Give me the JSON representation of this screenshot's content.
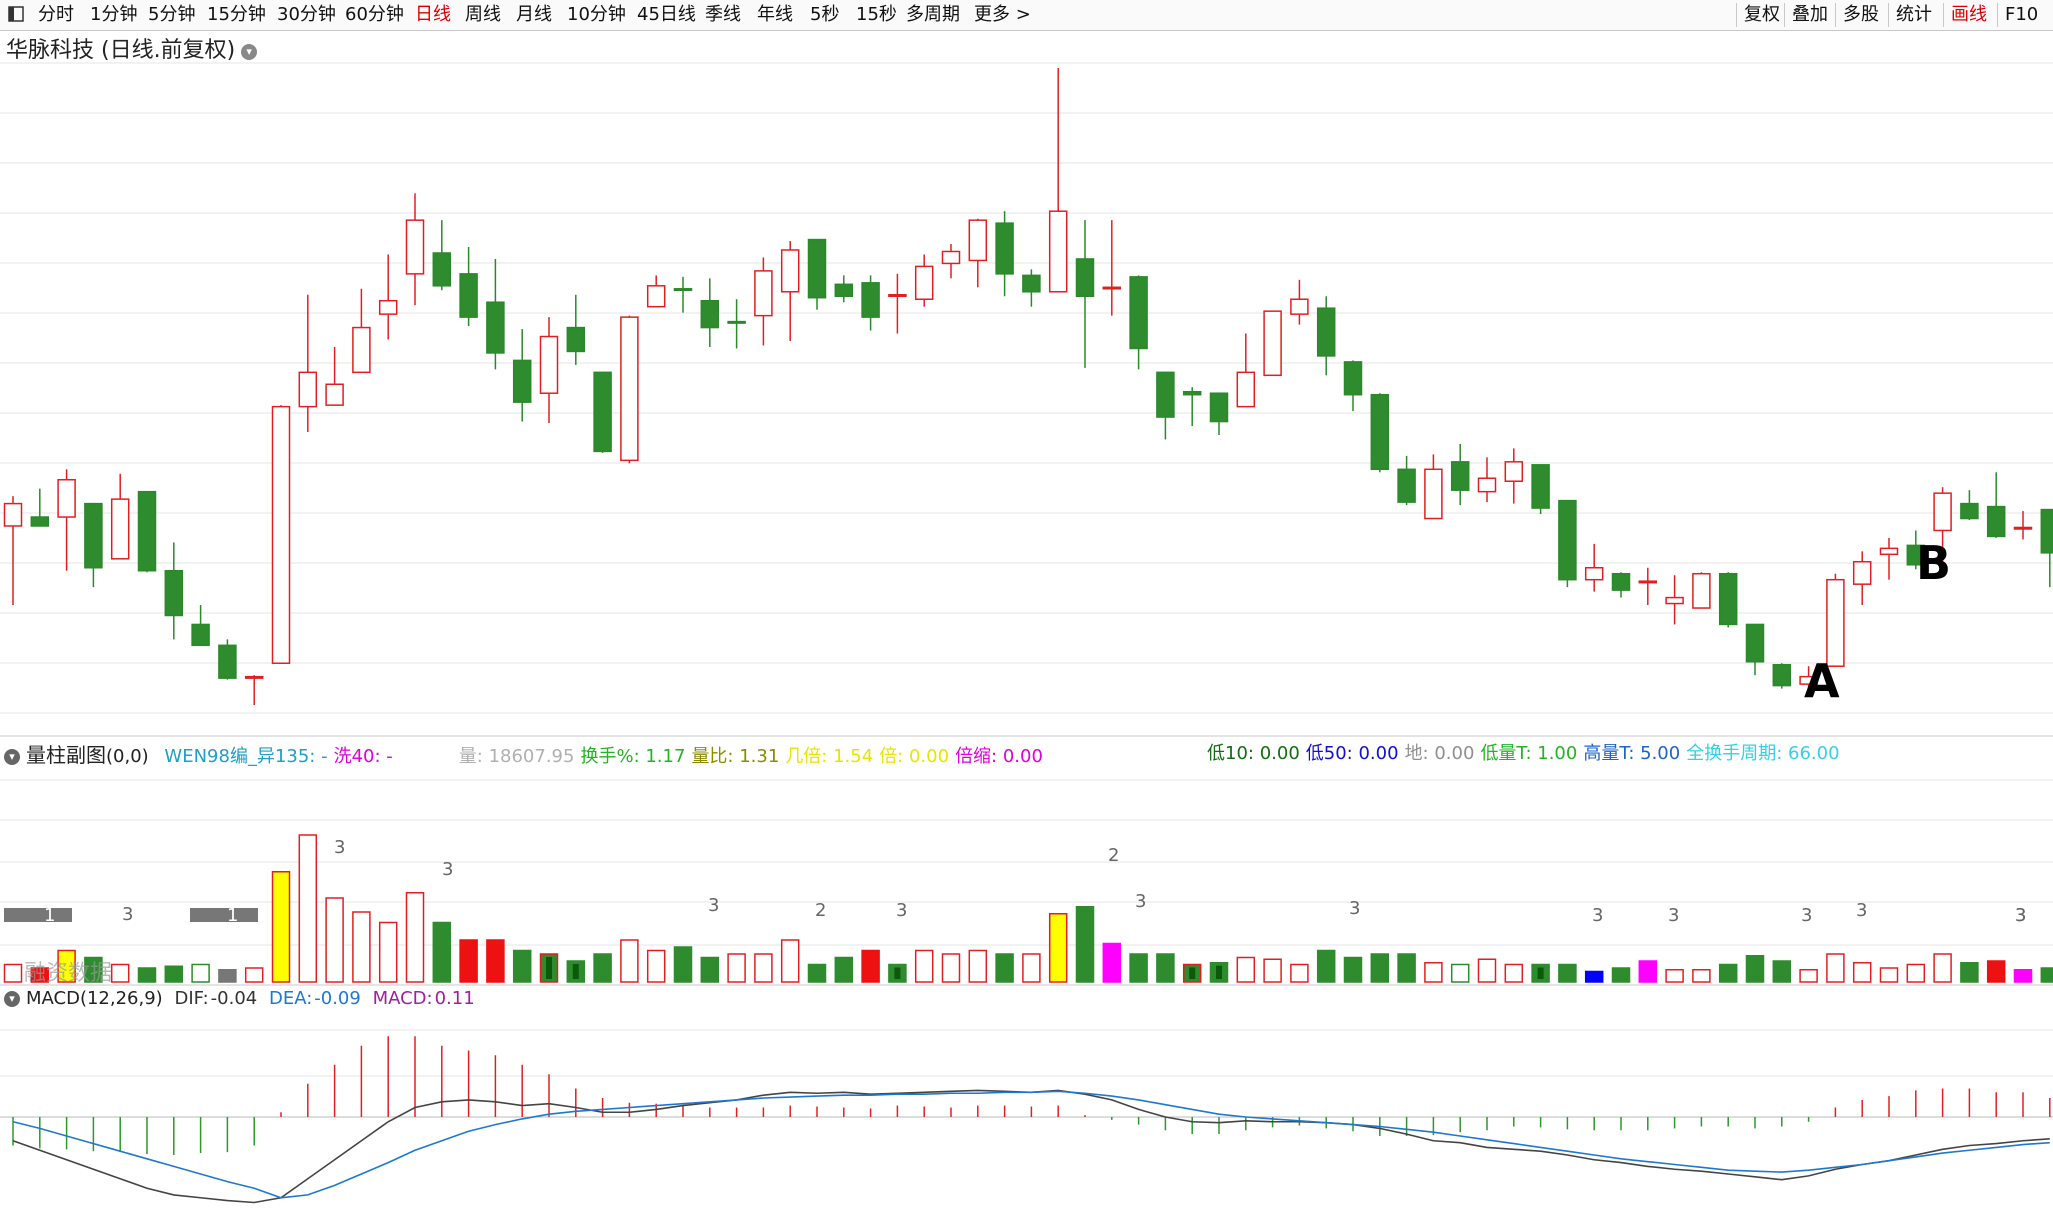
{
  "toolbar": {
    "left_tabs": [
      "分时",
      "1分钟",
      "5分钟",
      "15分钟",
      "30分钟",
      "60分钟",
      "日线",
      "周线",
      "月线",
      "10分钟",
      "45日线",
      "季线",
      "年线",
      "5秒",
      "15秒",
      "多周期",
      "更多 >"
    ],
    "active_tab": "日线",
    "right_tabs": [
      "复权",
      "叠加",
      "多股",
      "统计",
      "画线",
      "F10"
    ],
    "active_right": "画线"
  },
  "title": "华脉科技 (日线.前复权)",
  "volume_panel": {
    "name": "量柱副图",
    "params": "(0,0)",
    "items": [
      {
        "label": "WEN98编_异135:",
        "value": "-",
        "color": "#1ea0c8"
      },
      {
        "label": "洗40:",
        "value": "-",
        "color": "#e000e0"
      },
      {
        "label": "量:",
        "value": "18607.95",
        "color": "#b0b0b0"
      },
      {
        "label": "换手%:",
        "value": "1.17",
        "color": "#22b422"
      },
      {
        "label": "量比:",
        "value": "1.31",
        "color": "#8c8c00"
      },
      {
        "label": "几倍:",
        "value": "1.54",
        "color": "#e6e600"
      },
      {
        "label": "倍:",
        "value": "0.00",
        "color": "#e6e600"
      },
      {
        "label": "倍缩:",
        "value": "0.00",
        "color": "#e000e0"
      }
    ],
    "items2": [
      {
        "label": "低10:",
        "value": "0.00",
        "color": "#107010"
      },
      {
        "label": "低50:",
        "value": "0.00",
        "color": "#1010d0"
      },
      {
        "label": "地:",
        "value": "0.00",
        "color": "#909090"
      },
      {
        "label": "低量T:",
        "value": "1.00",
        "color": "#22b422"
      },
      {
        "label": "高量T:",
        "value": "5.00",
        "color": "#1e64c8"
      },
      {
        "label": "全换手周期:",
        "value": "66.00",
        "color": "#32d2e6"
      }
    ],
    "markers": [
      "1",
      "3",
      "1",
      "3",
      "3",
      "3",
      "2",
      "3",
      "2",
      "3",
      "3",
      "3",
      "3",
      "3",
      "3",
      "3",
      "3"
    ],
    "overlap_text": "融资数据"
  },
  "macd_panel": {
    "name": "MACD(12,26,9)",
    "dif_label": "DIF:",
    "dif": "-0.04",
    "dea_label": "DEA:",
    "dea": "-0.09",
    "macd_label": "MACD:",
    "macd": "0.11"
  },
  "annotations": {
    "a": "A",
    "b": "B"
  },
  "colors": {
    "up": "#e02020",
    "down": "#2a8a2a",
    "down_fill": "#2e8b2e",
    "grid": "#e6e6e6",
    "dif_line": "#444444",
    "dea_line": "#1f78d0",
    "yellow": "#ffff00",
    "magenta": "#ff00ff",
    "blue": "#0000ff"
  },
  "chart_data": {
    "type": "candlestick",
    "candles": [
      {
        "o": 54.5,
        "h": 56.5,
        "l": 49.2,
        "c": 56
      },
      {
        "o": 55.1,
        "h": 57.0,
        "l": 54.5,
        "c": 54.5
      },
      {
        "o": 55.1,
        "h": 58.3,
        "l": 51.5,
        "c": 57.6
      },
      {
        "o": 56,
        "h": 56,
        "l": 50.4,
        "c": 51.7
      },
      {
        "o": 52.3,
        "h": 58,
        "l": 52.3,
        "c": 56.3
      },
      {
        "o": 56.8,
        "h": 56.8,
        "l": 51.4,
        "c": 51.5
      },
      {
        "o": 51.5,
        "h": 53.4,
        "l": 46.9,
        "c": 48.5
      },
      {
        "o": 47.9,
        "h": 49.2,
        "l": 46.5,
        "c": 46.5
      },
      {
        "o": 46.5,
        "h": 46.9,
        "l": 44.2,
        "c": 44.3
      },
      {
        "o": 44.4,
        "h": 44.5,
        "l": 42.5,
        "c": 44.4
      },
      {
        "o": 45.3,
        "h": 62.6,
        "l": 45.3,
        "c": 62.5
      },
      {
        "o": 62.5,
        "h": 70.0,
        "l": 60.8,
        "c": 64.8
      },
      {
        "o": 62.6,
        "h": 66.5,
        "l": 62.6,
        "c": 64.0
      },
      {
        "o": 64.8,
        "h": 70.4,
        "l": 64.8,
        "c": 67.8
      },
      {
        "o": 68.7,
        "h": 72.7,
        "l": 67.0,
        "c": 69.6
      },
      {
        "o": 71.4,
        "h": 76.8,
        "l": 69.3,
        "c": 75.0
      },
      {
        "o": 72.8,
        "h": 75.0,
        "l": 70.3,
        "c": 70.6
      },
      {
        "o": 71.4,
        "h": 73.2,
        "l": 67.9,
        "c": 68.5
      },
      {
        "o": 69.5,
        "h": 72.4,
        "l": 65.0,
        "c": 66.1
      },
      {
        "o": 65.6,
        "h": 67.7,
        "l": 61.5,
        "c": 62.8
      },
      {
        "o": 63.4,
        "h": 68.5,
        "l": 61.4,
        "c": 67.2
      },
      {
        "o": 67.8,
        "h": 70.0,
        "l": 65.3,
        "c": 66.2
      },
      {
        "o": 64.8,
        "h": 64.8,
        "l": 59.4,
        "c": 59.5
      },
      {
        "o": 58.9,
        "h": 68.6,
        "l": 58.7,
        "c": 68.5
      },
      {
        "o": 69.2,
        "h": 71.3,
        "l": 69.2,
        "c": 70.6
      },
      {
        "o": 70.4,
        "h": 71.2,
        "l": 68.8,
        "c": 70.3
      },
      {
        "o": 69.6,
        "h": 71.1,
        "l": 66.5,
        "c": 67.8
      },
      {
        "o": 68.2,
        "h": 69.7,
        "l": 66.4,
        "c": 68.1
      },
      {
        "o": 68.6,
        "h": 72.5,
        "l": 66.6,
        "c": 71.6
      },
      {
        "o": 70.2,
        "h": 73.6,
        "l": 66.9,
        "c": 73.0
      },
      {
        "o": 73.7,
        "h": 73.7,
        "l": 69.0,
        "c": 69.8
      },
      {
        "o": 70.7,
        "h": 71.3,
        "l": 69.5,
        "c": 69.9
      },
      {
        "o": 70.8,
        "h": 71.3,
        "l": 67.6,
        "c": 68.5
      },
      {
        "o": 70.0,
        "h": 71.4,
        "l": 67.4,
        "c": 70.0
      },
      {
        "o": 69.7,
        "h": 72.7,
        "l": 69.2,
        "c": 71.9
      },
      {
        "o": 72.1,
        "h": 73.4,
        "l": 71.1,
        "c": 72.9
      },
      {
        "o": 72.3,
        "h": 75.1,
        "l": 70.5,
        "c": 75.0
      },
      {
        "o": 74.8,
        "h": 75.6,
        "l": 69.9,
        "c": 71.4
      },
      {
        "o": 71.3,
        "h": 71.7,
        "l": 69.2,
        "c": 70.2
      },
      {
        "o": 70.2,
        "h": 85.2,
        "l": 70.2,
        "c": 75.6
      },
      {
        "o": 72.4,
        "h": 75.0,
        "l": 65.1,
        "c": 69.9
      },
      {
        "o": 70.5,
        "h": 75.0,
        "l": 68.6,
        "c": 70.5
      },
      {
        "o": 71.2,
        "h": 71.3,
        "l": 65.0,
        "c": 66.4
      },
      {
        "o": 64.8,
        "h": 64.8,
        "l": 60.3,
        "c": 61.8
      },
      {
        "o": 63.5,
        "h": 63.8,
        "l": 61.2,
        "c": 63.3
      },
      {
        "o": 63.4,
        "h": 63.4,
        "l": 60.6,
        "c": 61.5
      },
      {
        "o": 62.5,
        "h": 67.4,
        "l": 62.5,
        "c": 64.8
      },
      {
        "o": 64.6,
        "h": 68.9,
        "l": 64.6,
        "c": 68.9
      },
      {
        "o": 68.7,
        "h": 71.0,
        "l": 68.0,
        "c": 69.7
      },
      {
        "o": 69.1,
        "h": 69.9,
        "l": 64.6,
        "c": 65.9
      },
      {
        "o": 65.5,
        "h": 65.6,
        "l": 62.2,
        "c": 63.3
      },
      {
        "o": 63.3,
        "h": 63.4,
        "l": 58.1,
        "c": 58.3
      },
      {
        "o": 58.3,
        "h": 59.2,
        "l": 55.9,
        "c": 56.1
      },
      {
        "o": 55.0,
        "h": 59.3,
        "l": 55.0,
        "c": 58.3
      },
      {
        "o": 58.8,
        "h": 60.0,
        "l": 55.9,
        "c": 56.9
      },
      {
        "o": 56.8,
        "h": 59.1,
        "l": 56.1,
        "c": 57.7
      },
      {
        "o": 57.5,
        "h": 59.7,
        "l": 56.0,
        "c": 58.8
      },
      {
        "o": 58.6,
        "h": 58.6,
        "l": 55.3,
        "c": 55.7
      },
      {
        "o": 56.2,
        "h": 56.2,
        "l": 50.4,
        "c": 50.9
      },
      {
        "o": 50.9,
        "h": 53.3,
        "l": 50.1,
        "c": 51.7
      },
      {
        "o": 51.3,
        "h": 51.4,
        "l": 49.7,
        "c": 50.2
      },
      {
        "o": 50.7,
        "h": 51.7,
        "l": 49.2,
        "c": 50.8
      },
      {
        "o": 49.3,
        "h": 51.2,
        "l": 47.9,
        "c": 49.7
      },
      {
        "o": 49.0,
        "h": 51.4,
        "l": 49.0,
        "c": 51.3
      },
      {
        "o": 51.3,
        "h": 51.4,
        "l": 47.7,
        "c": 47.9
      },
      {
        "o": 47.9,
        "h": 47.9,
        "l": 44.5,
        "c": 45.4
      },
      {
        "o": 45.2,
        "h": 45.3,
        "l": 43.6,
        "c": 43.8
      },
      {
        "o": 43.9,
        "h": 45.1,
        "l": 43.6,
        "c": 44.4
      },
      {
        "o": 45.1,
        "h": 51.3,
        "l": 45.1,
        "c": 50.9
      },
      {
        "o": 50.6,
        "h": 52.8,
        "l": 49.2,
        "c": 52.1
      },
      {
        "o": 52.6,
        "h": 53.7,
        "l": 50.9,
        "c": 53.0
      },
      {
        "o": 53.2,
        "h": 54.2,
        "l": 51.6,
        "c": 51.9
      },
      {
        "o": 54.2,
        "h": 57.1,
        "l": 51.5,
        "c": 56.7
      },
      {
        "o": 56.0,
        "h": 56.9,
        "l": 54.9,
        "c": 55.0
      },
      {
        "o": 55.8,
        "h": 58.1,
        "l": 53.7,
        "c": 53.8
      },
      {
        "o": 54.4,
        "h": 55.5,
        "l": 53.6,
        "c": 54.4
      },
      {
        "o": 55.6,
        "h": 55.6,
        "l": 50.4,
        "c": 52.7
      }
    ],
    "volumes": [
      {
        "v": 10,
        "k": "up"
      },
      {
        "v": 8,
        "k": "red"
      },
      {
        "v": 18,
        "k": "yellow"
      },
      {
        "v": 14,
        "k": "down"
      },
      {
        "v": 10,
        "k": "up"
      },
      {
        "v": 8,
        "k": "down"
      },
      {
        "v": 9,
        "k": "down"
      },
      {
        "v": 10,
        "k": "uphollowgreen"
      },
      {
        "v": 7,
        "k": "gray"
      },
      {
        "v": 8,
        "k": "up"
      },
      {
        "v": 63,
        "k": "yellow"
      },
      {
        "v": 84,
        "k": "up"
      },
      {
        "v": 48,
        "k": "up"
      },
      {
        "v": 40,
        "k": "up"
      },
      {
        "v": 34,
        "k": "up"
      },
      {
        "v": 51,
        "k": "up"
      },
      {
        "v": 34,
        "k": "down"
      },
      {
        "v": 24,
        "k": "red"
      },
      {
        "v": 24,
        "k": "red"
      },
      {
        "v": 18,
        "k": "down"
      },
      {
        "v": 16,
        "k": "upgreen"
      },
      {
        "v": 12,
        "k": "downdark"
      },
      {
        "v": 16,
        "k": "down"
      },
      {
        "v": 24,
        "k": "up"
      },
      {
        "v": 18,
        "k": "up"
      },
      {
        "v": 20,
        "k": "down"
      },
      {
        "v": 14,
        "k": "down"
      },
      {
        "v": 16,
        "k": "up"
      },
      {
        "v": 16,
        "k": "up"
      },
      {
        "v": 24,
        "k": "up"
      },
      {
        "v": 10,
        "k": "down"
      },
      {
        "v": 14,
        "k": "down"
      },
      {
        "v": 18,
        "k": "red"
      },
      {
        "v": 10,
        "k": "downdark"
      },
      {
        "v": 18,
        "k": "up"
      },
      {
        "v": 16,
        "k": "up"
      },
      {
        "v": 18,
        "k": "up"
      },
      {
        "v": 16,
        "k": "down"
      },
      {
        "v": 16,
        "k": "up"
      },
      {
        "v": 39,
        "k": "yellow"
      },
      {
        "v": 43,
        "k": "down"
      },
      {
        "v": 22,
        "k": "magenta"
      },
      {
        "v": 16,
        "k": "down"
      },
      {
        "v": 16,
        "k": "down"
      },
      {
        "v": 10,
        "k": "upgreen"
      },
      {
        "v": 11,
        "k": "downdark"
      },
      {
        "v": 14,
        "k": "up"
      },
      {
        "v": 13,
        "k": "up"
      },
      {
        "v": 10,
        "k": "up"
      },
      {
        "v": 18,
        "k": "down"
      },
      {
        "v": 14,
        "k": "down"
      },
      {
        "v": 16,
        "k": "down"
      },
      {
        "v": 16,
        "k": "down"
      },
      {
        "v": 11,
        "k": "up"
      },
      {
        "v": 10,
        "k": "uphollowgreen"
      },
      {
        "v": 13,
        "k": "up"
      },
      {
        "v": 10,
        "k": "up"
      },
      {
        "v": 10,
        "k": "downdark"
      },
      {
        "v": 10,
        "k": "down"
      },
      {
        "v": 6,
        "k": "blue"
      },
      {
        "v": 8,
        "k": "down"
      },
      {
        "v": 12,
        "k": "magenta"
      },
      {
        "v": 7,
        "k": "up"
      },
      {
        "v": 7,
        "k": "up"
      },
      {
        "v": 10,
        "k": "down"
      },
      {
        "v": 15,
        "k": "down"
      },
      {
        "v": 12,
        "k": "down"
      },
      {
        "v": 7,
        "k": "up"
      },
      {
        "v": 16,
        "k": "up"
      },
      {
        "v": 11,
        "k": "up"
      },
      {
        "v": 8,
        "k": "up"
      },
      {
        "v": 10,
        "k": "up"
      },
      {
        "v": 16,
        "k": "up"
      },
      {
        "v": 11,
        "k": "down"
      },
      {
        "v": 12,
        "k": "red"
      },
      {
        "v": 7,
        "k": "magenta"
      },
      {
        "v": 8,
        "k": "down"
      }
    ],
    "macd_hist": [
      -0.3,
      -0.33,
      -0.34,
      -0.36,
      -0.37,
      -0.39,
      -0.4,
      -0.38,
      -0.37,
      -0.3,
      0.05,
      0.35,
      0.55,
      0.75,
      0.85,
      0.85,
      0.75,
      0.7,
      0.65,
      0.55,
      0.45,
      0.3,
      0.2,
      0.15,
      0.14,
      0.12,
      0.1,
      0.1,
      0.1,
      0.12,
      0.11,
      0.1,
      0.09,
      0.12,
      0.11,
      0.1,
      0.12,
      0.12,
      0.11,
      0.12,
      0.02,
      -0.03,
      -0.08,
      -0.14,
      -0.18,
      -0.18,
      -0.14,
      -0.11,
      -0.09,
      -0.12,
      -0.15,
      -0.2,
      -0.2,
      -0.19,
      -0.16,
      -0.14,
      -0.1,
      -0.11,
      -0.13,
      -0.14,
      -0.14,
      -0.14,
      -0.12,
      -0.1,
      -0.1,
      -0.12,
      -0.1,
      -0.05,
      0.1,
      0.18,
      0.22,
      0.28,
      0.3,
      0.3,
      0.26,
      0.26,
      0.2
    ],
    "dif": [
      -0.25,
      -0.35,
      -0.45,
      -0.55,
      -0.65,
      -0.75,
      -0.82,
      -0.85,
      -0.88,
      -0.9,
      -0.85,
      -0.65,
      -0.45,
      -0.25,
      -0.05,
      0.1,
      0.16,
      0.18,
      0.16,
      0.12,
      0.14,
      0.1,
      0.05,
      0.05,
      0.08,
      0.12,
      0.15,
      0.18,
      0.23,
      0.26,
      0.25,
      0.26,
      0.24,
      0.25,
      0.26,
      0.27,
      0.28,
      0.27,
      0.26,
      0.28,
      0.24,
      0.18,
      0.08,
      0.0,
      -0.05,
      -0.06,
      -0.04,
      -0.05,
      -0.05,
      -0.06,
      -0.08,
      -0.12,
      -0.18,
      -0.25,
      -0.27,
      -0.32,
      -0.34,
      -0.36,
      -0.4,
      -0.45,
      -0.48,
      -0.52,
      -0.55,
      -0.57,
      -0.6,
      -0.63,
      -0.66,
      -0.62,
      -0.55,
      -0.5,
      -0.46,
      -0.4,
      -0.34,
      -0.3,
      -0.28,
      -0.25,
      -0.23
    ],
    "dea": [
      -0.05,
      -0.12,
      -0.2,
      -0.28,
      -0.36,
      -0.44,
      -0.52,
      -0.6,
      -0.68,
      -0.75,
      -0.85,
      -0.82,
      -0.72,
      -0.6,
      -0.48,
      -0.35,
      -0.25,
      -0.15,
      -0.08,
      -0.02,
      0.03,
      0.06,
      0.08,
      0.1,
      0.12,
      0.14,
      0.16,
      0.18,
      0.2,
      0.21,
      0.22,
      0.23,
      0.23,
      0.24,
      0.24,
      0.25,
      0.25,
      0.26,
      0.26,
      0.27,
      0.25,
      0.22,
      0.18,
      0.13,
      0.08,
      0.03,
      0.0,
      -0.02,
      -0.04,
      -0.06,
      -0.08,
      -0.1,
      -0.13,
      -0.16,
      -0.2,
      -0.24,
      -0.28,
      -0.32,
      -0.36,
      -0.4,
      -0.44,
      -0.47,
      -0.5,
      -0.53,
      -0.56,
      -0.57,
      -0.58,
      -0.56,
      -0.53,
      -0.5,
      -0.46,
      -0.42,
      -0.38,
      -0.35,
      -0.32,
      -0.29,
      -0.27
    ]
  }
}
